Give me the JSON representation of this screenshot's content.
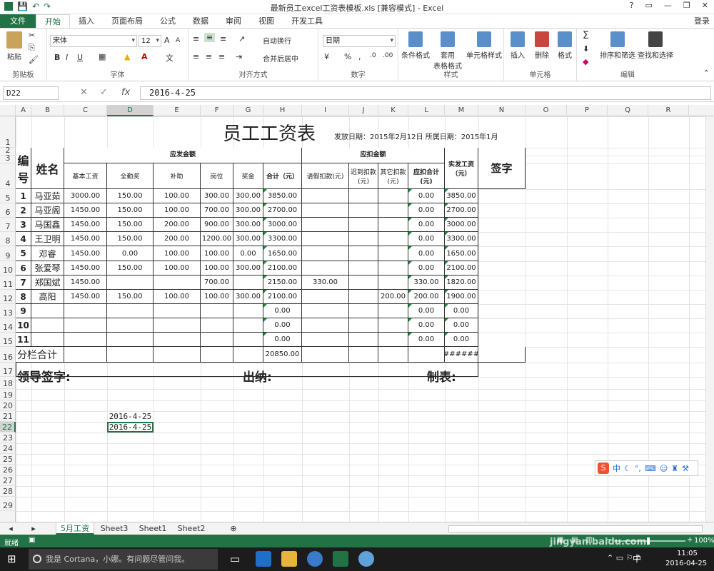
{
  "window": {
    "title": "最新员工excel工资表模板.xls  [兼容模式] - Excel",
    "help": "?",
    "login": "登录"
  },
  "tabs": [
    "文件",
    "开始",
    "插入",
    "页面布局",
    "公式",
    "数据",
    "审阅",
    "视图",
    "开发工具"
  ],
  "ribbon": {
    "clipboard": {
      "label": "剪贴板",
      "paste": "粘贴"
    },
    "font": {
      "label": "字体",
      "name": "宋体",
      "size": "12",
      "bold": "B",
      "italic": "I",
      "underline": "U",
      "grow": "A",
      "shrink": "A"
    },
    "align": {
      "label": "对齐方式",
      "wrap": "自动换行",
      "merge": "合并后居中"
    },
    "number": {
      "label": "数字",
      "format": "日期",
      "percent": "%",
      "comma": ","
    },
    "styles": {
      "label": "样式",
      "cond": "条件格式",
      "table1": "套用",
      "table2": "表格格式",
      "cell": "单元格样式"
    },
    "cells": {
      "label": "单元格",
      "insert": "插入",
      "delete": "删除",
      "format": "格式"
    },
    "edit": {
      "label": "编辑",
      "sigma": "Σ",
      "sort": "排序和筛选",
      "find": "查找和选择"
    }
  },
  "formula": {
    "namebox": "D22",
    "fx": "fx",
    "value": "2016-4-25"
  },
  "columns": [
    "A",
    "B",
    "C",
    "D",
    "E",
    "F",
    "G",
    "H",
    "I",
    "J",
    "K",
    "L",
    "M",
    "N",
    "O",
    "P",
    "Q",
    "R"
  ],
  "rows": [
    "1",
    "2",
    "3",
    "4",
    "5",
    "6",
    "7",
    "8",
    "9",
    "10",
    "11",
    "12",
    "13",
    "14",
    "15",
    "16",
    "17",
    "18",
    "19",
    "20",
    "21",
    "22",
    "23",
    "24",
    "25",
    "26",
    "27",
    "28",
    "29"
  ],
  "sheet": {
    "title": "员工工资表",
    "issue": "发放日期：2015年2月12日 所属日期：2015年1月",
    "h_no": "编号",
    "h_name": "姓名",
    "h_pay": "应发金额",
    "h_ded": "应扣金额",
    "h_net": "实发工资（元）",
    "h_sign": "签字",
    "sub": [
      "基本工资",
      "全勤奖",
      "补助",
      "岗位",
      "奖金",
      "合计（元）",
      "请假扣款(元)",
      "迟到扣款(元)",
      "其它扣款(元)",
      "应扣合计(元)"
    ],
    "data": [
      [
        "1",
        "马亚茹",
        "3000.00",
        "150.00",
        "100.00",
        "300.00",
        "300.00",
        "3850.00",
        "",
        "",
        "",
        "0.00",
        "3850.00"
      ],
      [
        "2",
        "马亚阁",
        "1450.00",
        "150.00",
        "100.00",
        "700.00",
        "300.00",
        "2700.00",
        "",
        "",
        "",
        "0.00",
        "2700.00"
      ],
      [
        "3",
        "马国鑫",
        "1450.00",
        "150.00",
        "200.00",
        "900.00",
        "300.00",
        "3000.00",
        "",
        "",
        "",
        "0.00",
        "3000.00"
      ],
      [
        "4",
        "王卫明",
        "1450.00",
        "150.00",
        "200.00",
        "1200.00",
        "300.00",
        "3300.00",
        "",
        "",
        "",
        "0.00",
        "3300.00"
      ],
      [
        "5",
        "邓睿",
        "1450.00",
        "0.00",
        "100.00",
        "100.00",
        "0.00",
        "1650.00",
        "",
        "",
        "",
        "0.00",
        "1650.00"
      ],
      [
        "6",
        "张爱琴",
        "1450.00",
        "150.00",
        "100.00",
        "100.00",
        "300.00",
        "2100.00",
        "",
        "",
        "",
        "0.00",
        "2100.00"
      ],
      [
        "7",
        "郑国斌",
        "1450.00",
        "",
        "",
        "700.00",
        "",
        "2150.00",
        "330.00",
        "",
        "",
        "330.00",
        "1820.00"
      ],
      [
        "8",
        "高阳",
        "1450.00",
        "150.00",
        "100.00",
        "100.00",
        "300.00",
        "2100.00",
        "",
        "",
        "200.00",
        "200.00",
        "1900.00"
      ],
      [
        "9",
        "",
        "",
        "",
        "",
        "",
        "",
        "0.00",
        "",
        "",
        "",
        "0.00",
        "0.00"
      ],
      [
        "10",
        "",
        "",
        "",
        "",
        "",
        "",
        "0.00",
        "",
        "",
        "",
        "0.00",
        "0.00"
      ],
      [
        "11",
        "",
        "",
        "",
        "",
        "",
        "",
        "0.00",
        "",
        "",
        "",
        "0.00",
        "0.00"
      ]
    ],
    "total_label": "分栏合计",
    "total_sum": "20850.00",
    "total_net": "######",
    "sig_leader": "领导签字:",
    "sig_cashier": "出纳:",
    "sig_maker": "制表:",
    "d21": "2016-4-25",
    "d22": "2016-4-25"
  },
  "sheettabs": [
    "5月工资",
    "Sheet3",
    "Sheet1",
    "Sheet2"
  ],
  "statusbar": {
    "ready": "就绪",
    "zoom": "100%"
  },
  "taskbar": {
    "cortana": "我是 Cortana，小娜。有问题尽管问我。",
    "time": "11:05",
    "date": "2016-04-25",
    "ime": "中"
  },
  "watermark": "jingyan.baidu.com"
}
